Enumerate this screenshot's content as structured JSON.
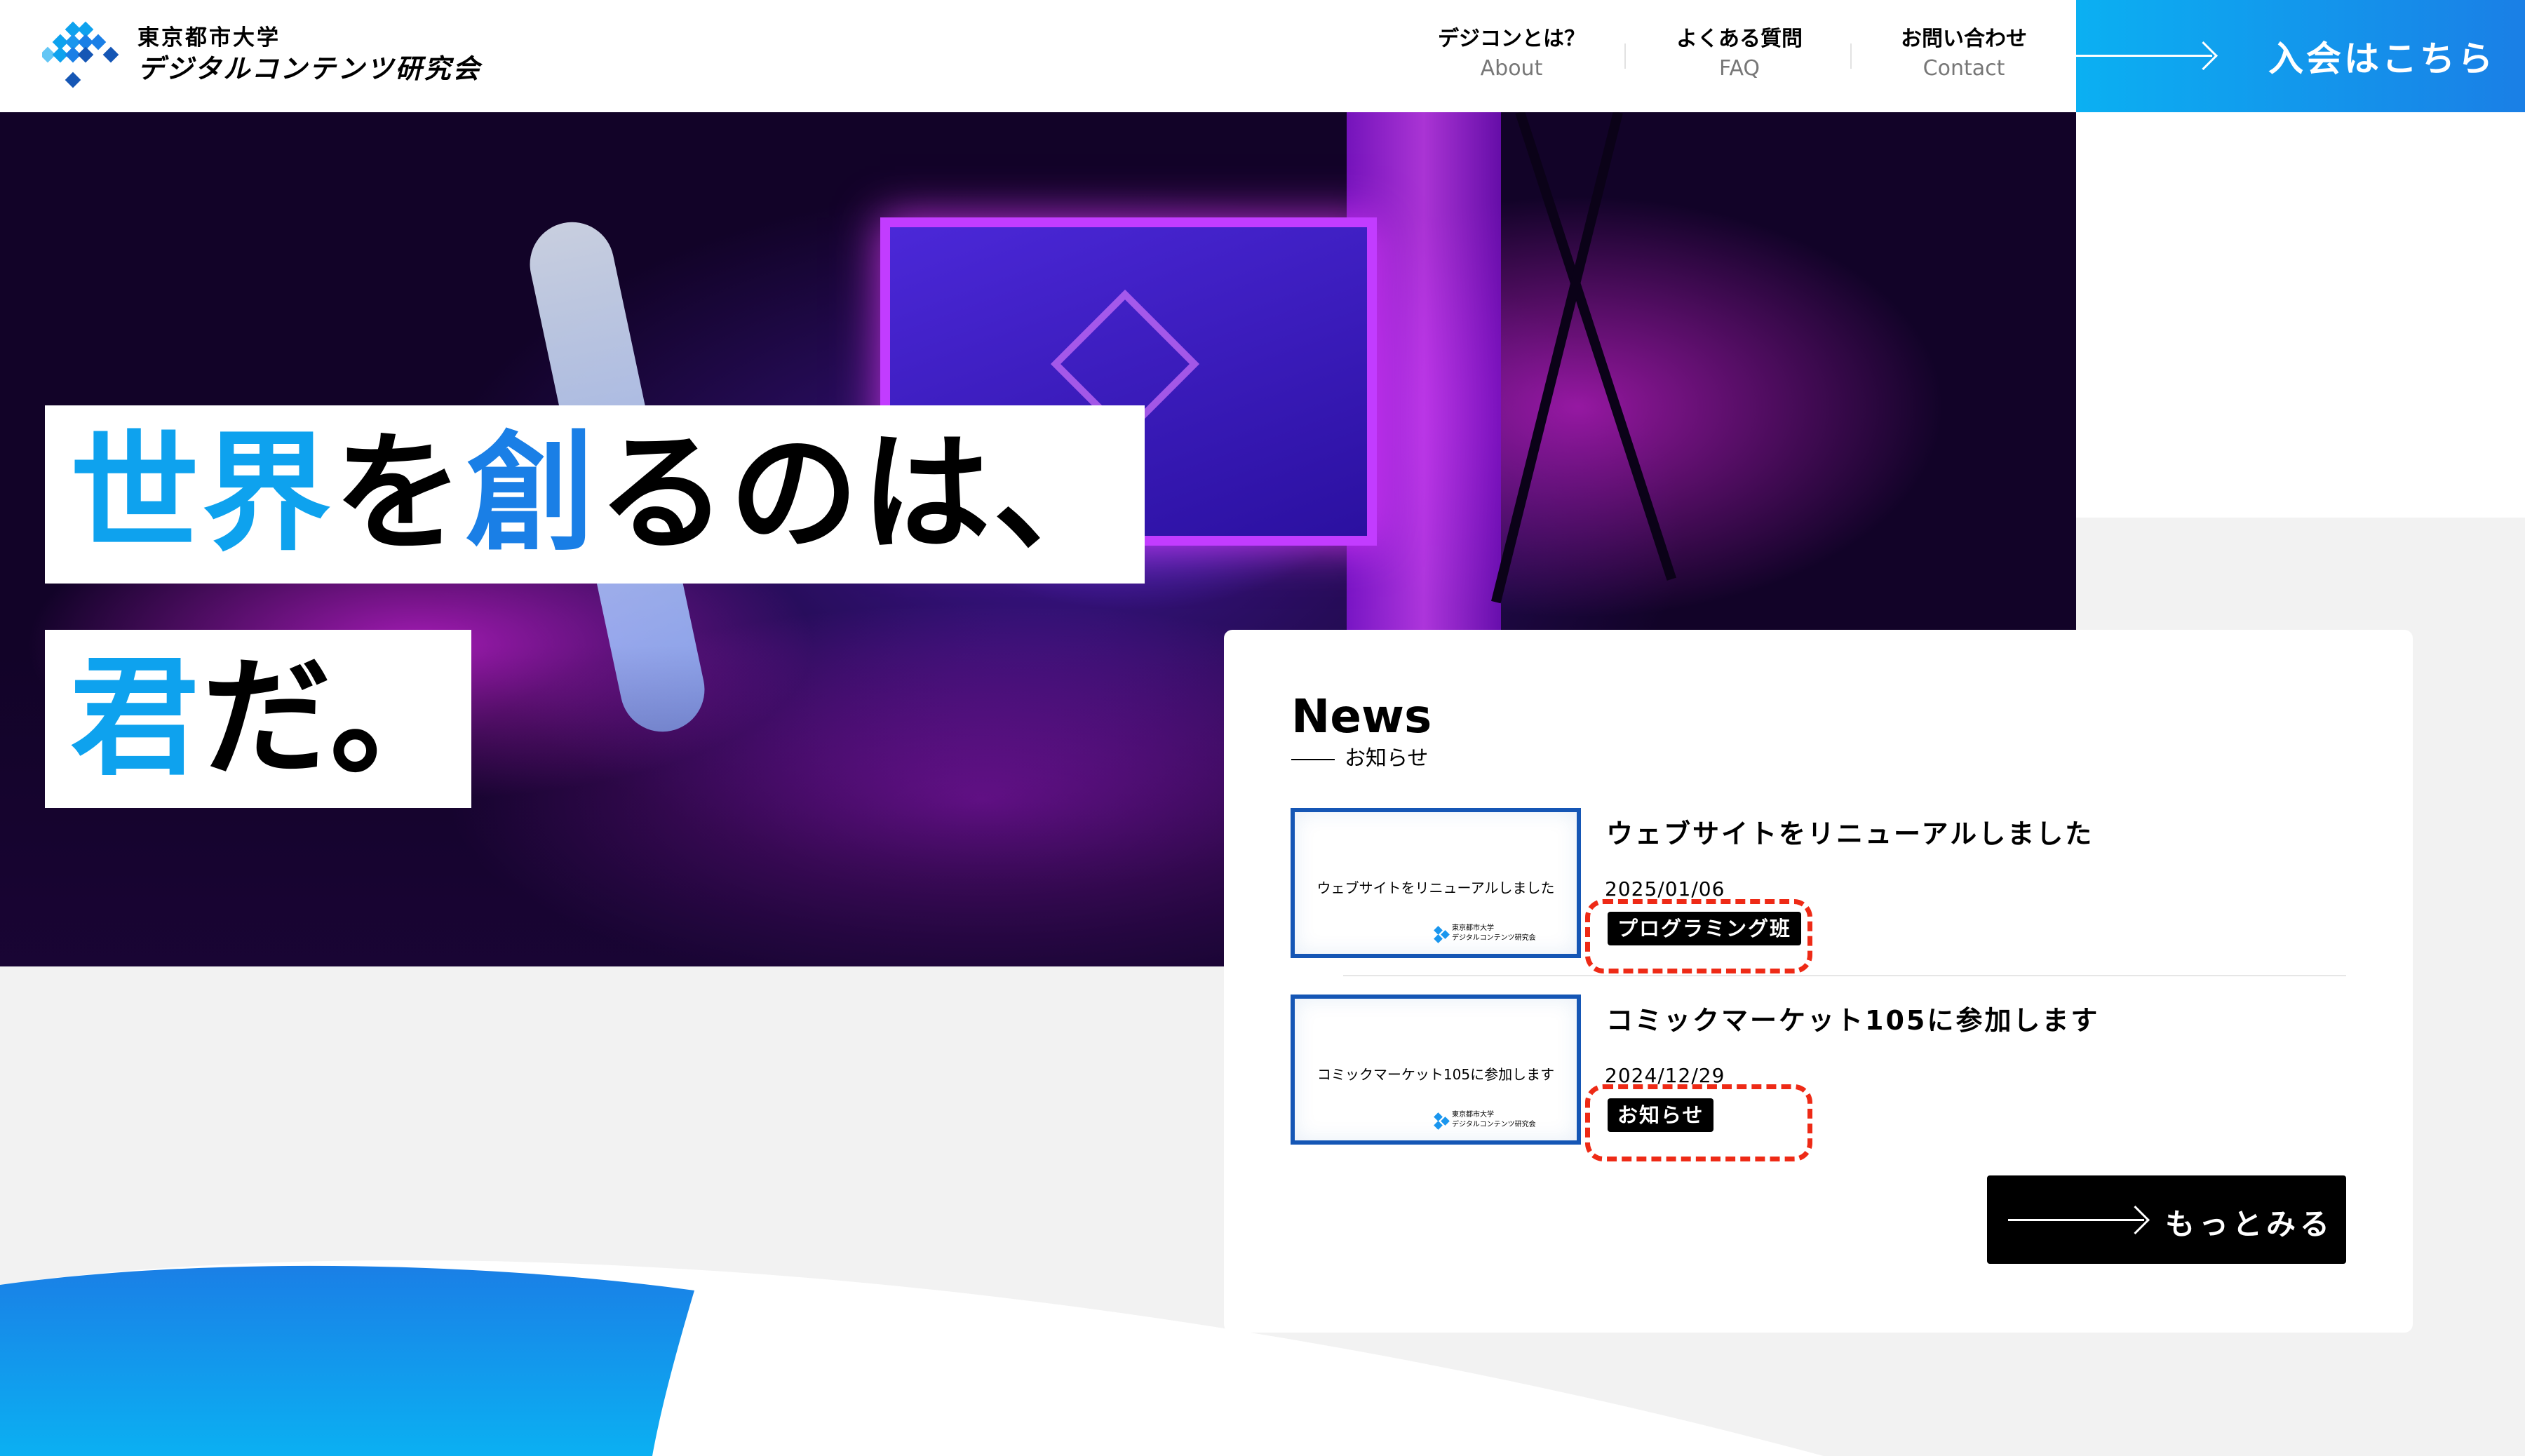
{
  "header": {
    "logo_line1": "東京都市大学",
    "logo_line2": "デジタルコンテンツ研究会",
    "nav": [
      {
        "jp": "デジコンとは？",
        "en": "About"
      },
      {
        "jp": "よくある質問",
        "en": "FAQ"
      },
      {
        "jp": "お問い合わせ",
        "en": "Contact"
      }
    ],
    "join_label": "入会はこちら"
  },
  "hero": {
    "line1": [
      {
        "text": "世界",
        "color": "#0ea2ee"
      },
      {
        "text": "を",
        "color": "#000000"
      },
      {
        "text": "創",
        "color": "#1a7fe6"
      },
      {
        "text": "るのは、",
        "color": "#000000"
      }
    ],
    "line2": [
      {
        "text": "君",
        "color": "#0ea2ee"
      },
      {
        "text": "だ。",
        "color": "#000000"
      }
    ]
  },
  "news": {
    "title": "News",
    "subtitle": "お知らせ",
    "items": [
      {
        "thumb_text": "ウェブサイトをリニューアルしました",
        "thumb_logo_line1": "東京都市大学",
        "thumb_logo_line2": "デジタルコンテンツ研究会",
        "title": "ウェブサイトをリニューアルしました",
        "date": "2025/01/06",
        "tag": "プログラミング班"
      },
      {
        "thumb_text": "コミックマーケット105に参加します",
        "thumb_logo_line1": "東京都市大学",
        "thumb_logo_line2": "デジタルコンテンツ研究会",
        "title": "コミックマーケット105に参加します",
        "date": "2024/12/29",
        "tag": "お知らせ"
      }
    ],
    "more_label": "もっとみる"
  },
  "colors": {
    "accent_blue": "#0ea2ee",
    "accent_blue_dark": "#1a7fe6",
    "annotation_red": "#ee2a16"
  }
}
